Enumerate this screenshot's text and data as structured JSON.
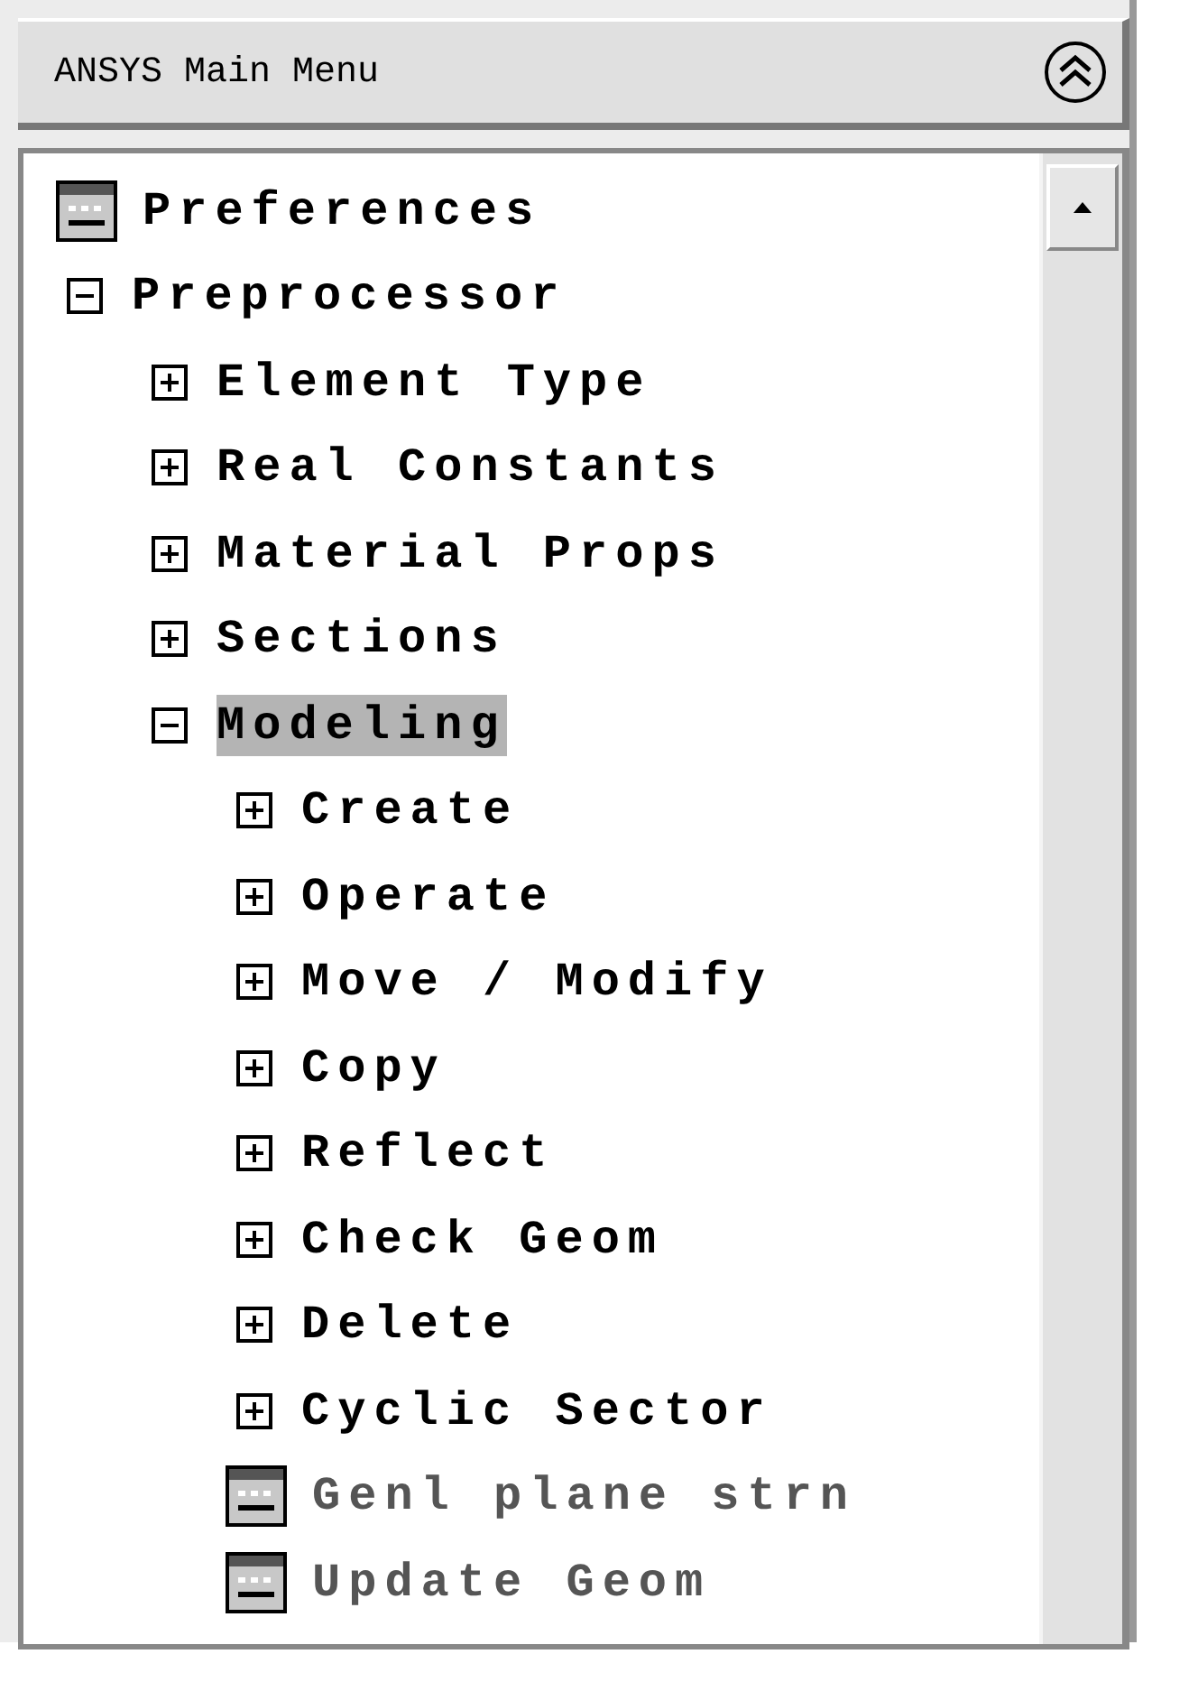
{
  "menu": {
    "title": "ANSYS Main Menu"
  },
  "tree": [
    {
      "label": "Preferences",
      "kind": "dialog",
      "disabled": false,
      "selected": false
    },
    {
      "label": "Preprocessor",
      "kind": "folder",
      "expanded": true,
      "selected": false,
      "children": [
        {
          "label": "Element Type",
          "kind": "folder",
          "expanded": false,
          "selected": false
        },
        {
          "label": "Real Constants",
          "kind": "folder",
          "expanded": false,
          "selected": false
        },
        {
          "label": "Material Props",
          "kind": "folder",
          "expanded": false,
          "selected": false
        },
        {
          "label": "Sections",
          "kind": "folder",
          "expanded": false,
          "selected": false
        },
        {
          "label": "Modeling",
          "kind": "folder",
          "expanded": true,
          "selected": true,
          "children": [
            {
              "label": "Create",
              "kind": "folder",
              "expanded": false,
              "selected": false
            },
            {
              "label": "Operate",
              "kind": "folder",
              "expanded": false,
              "selected": false
            },
            {
              "label": "Move / Modify",
              "kind": "folder",
              "expanded": false,
              "selected": false
            },
            {
              "label": "Copy",
              "kind": "folder",
              "expanded": false,
              "selected": false
            },
            {
              "label": "Reflect",
              "kind": "folder",
              "expanded": false,
              "selected": false
            },
            {
              "label": "Check Geom",
              "kind": "folder",
              "expanded": false,
              "selected": false
            },
            {
              "label": "Delete",
              "kind": "folder",
              "expanded": false,
              "selected": false
            },
            {
              "label": "Cyclic Sector",
              "kind": "folder",
              "expanded": false,
              "selected": false
            },
            {
              "label": "Genl plane strn",
              "kind": "dialog",
              "disabled": true,
              "selected": false
            },
            {
              "label": "Update Geom",
              "kind": "dialog",
              "disabled": true,
              "selected": false
            }
          ]
        }
      ]
    }
  ]
}
